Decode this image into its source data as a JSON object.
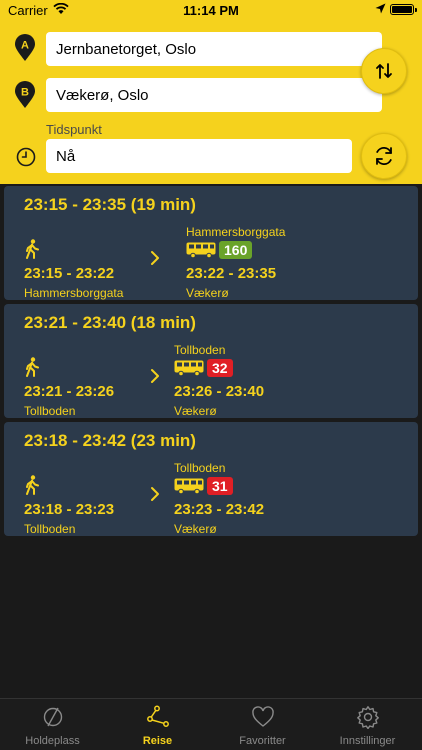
{
  "status_bar": {
    "carrier": "Carrier",
    "time": "11:14 PM"
  },
  "search": {
    "from_marker": "A",
    "from_value": "Jernbanetorget, Oslo",
    "to_marker": "B",
    "to_value": "Vækerø, Oslo",
    "time_label": "Tidspunkt",
    "time_value": "Nå"
  },
  "trips": [
    {
      "title": "23:15 - 23:35 (19 min)",
      "leg1_time": "23:15 - 23:22",
      "leg1_stop": "Hammersborggata",
      "leg2_stop": "Hammersborggata",
      "line": "160",
      "line_color": "#6aa329",
      "leg2_time": "23:22 - 23:35",
      "leg2_dest": "Vækerø"
    },
    {
      "title": "23:21 - 23:40 (18 min)",
      "leg1_time": "23:21 - 23:26",
      "leg1_stop": "Tollboden",
      "leg2_stop": "Tollboden",
      "line": "32",
      "line_color": "#e01f25",
      "leg2_time": "23:26 - 23:40",
      "leg2_dest": "Vækerø"
    },
    {
      "title": "23:18 - 23:42 (23 min)",
      "leg1_time": "23:18 - 23:23",
      "leg1_stop": "Tollboden",
      "leg2_stop": "Tollboden",
      "line": "31",
      "line_color": "#e01f25",
      "leg2_time": "23:23 - 23:42",
      "leg2_dest": "Vækerø"
    }
  ],
  "tabbar": [
    {
      "label": "Holdeplass",
      "icon": "stop-icon"
    },
    {
      "label": "Reise",
      "icon": "route-icon"
    },
    {
      "label": "Favoritter",
      "icon": "heart-icon"
    },
    {
      "label": "Innstillinger",
      "icon": "gear-icon"
    }
  ],
  "colors": {
    "accent": "#f5d21d",
    "card": "#2c3a4b",
    "background": "#1a1a1a"
  }
}
